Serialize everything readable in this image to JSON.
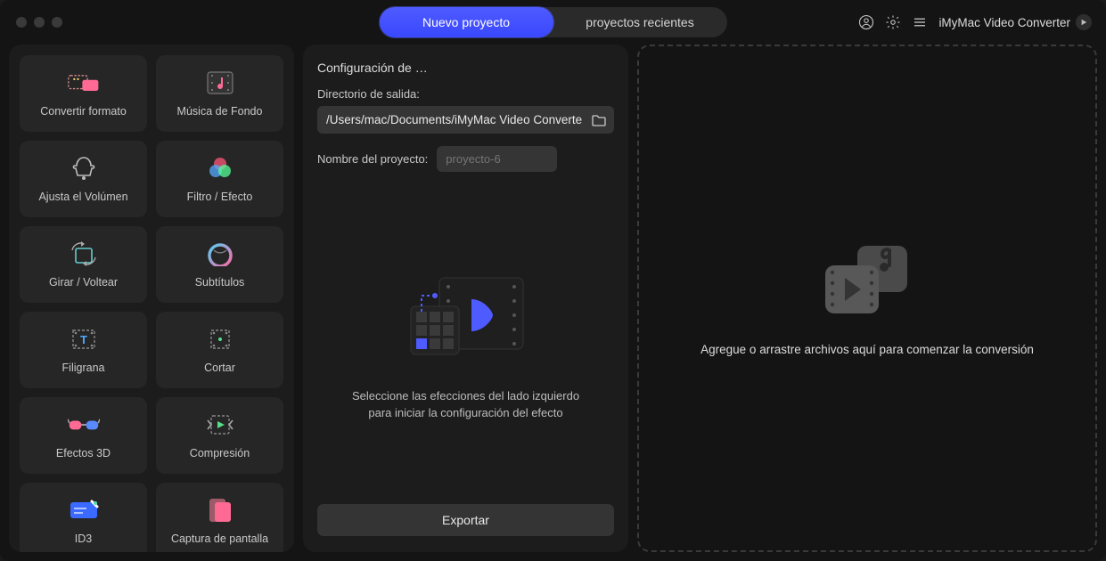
{
  "window": {
    "app_name": "iMyMac Video Converter"
  },
  "tabs": {
    "new_project": "Nuevo proyecto",
    "recent_projects": "proyectos recientes"
  },
  "sidebar": {
    "tiles": [
      {
        "label": "Convertir formato",
        "icon": "convert"
      },
      {
        "label": "Música de Fondo",
        "icon": "music"
      },
      {
        "label": "Ajusta el Volúmen",
        "icon": "volume"
      },
      {
        "label": "Filtro / Efecto",
        "icon": "filter"
      },
      {
        "label": "Girar / Voltear",
        "icon": "rotate"
      },
      {
        "label": "Subtítulos",
        "icon": "subtitle"
      },
      {
        "label": "Filigrana",
        "icon": "watermark"
      },
      {
        "label": "Cortar",
        "icon": "crop"
      },
      {
        "label": "Efectos 3D",
        "icon": "glasses3d"
      },
      {
        "label": "Compresión",
        "icon": "compress"
      },
      {
        "label": "ID3",
        "icon": "id3"
      },
      {
        "label": "Captura de pantalla",
        "icon": "screenshot"
      }
    ]
  },
  "config": {
    "title": "Configuración de …",
    "output_label": "Directorio de salida:",
    "output_path": "/Users/mac/Documents/iMyMac Video Converte",
    "project_name_label": "Nombre del proyecto:",
    "project_name_placeholder": "proyecto-6",
    "hint": "Seleccione las efecciones del lado izquierdo para iniciar la configuración del efecto",
    "export_label": "Exportar"
  },
  "drop": {
    "text": "Agregue o arrastre archivos aquí para comenzar la conversión"
  }
}
